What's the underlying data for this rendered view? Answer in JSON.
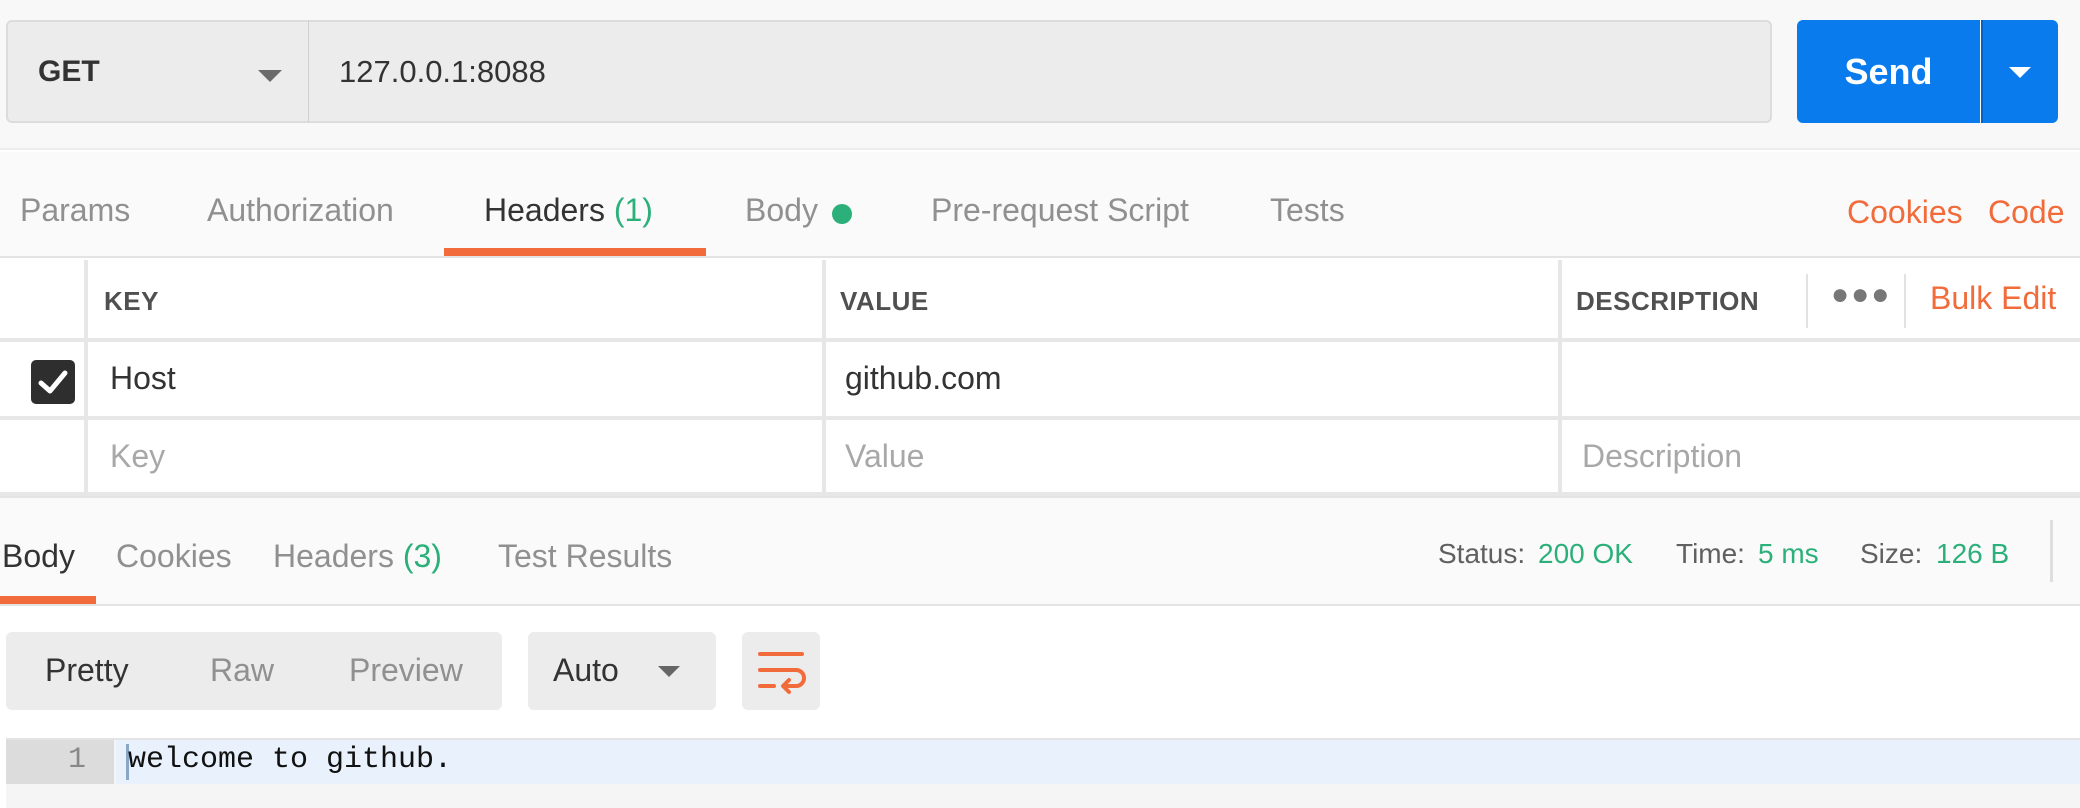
{
  "request": {
    "method": "GET",
    "url": "127.0.0.1:8088",
    "send_label": "Send"
  },
  "request_tabs": {
    "params": "Params",
    "authorization": "Authorization",
    "headers": "Headers",
    "headers_count": "(1)",
    "body": "Body",
    "prerequest": "Pre-request Script",
    "tests": "Tests",
    "cookies_link": "Cookies",
    "code_link": "Code"
  },
  "headers_table": {
    "columns": {
      "key": "KEY",
      "value": "VALUE",
      "description": "DESCRIPTION"
    },
    "more_icon": "more-dots-icon",
    "bulk_edit": "Bulk Edit",
    "rows": [
      {
        "checked": true,
        "key": "Host",
        "value": "github.com",
        "description": ""
      }
    ],
    "placeholders": {
      "key": "Key",
      "value": "Value",
      "description": "Description"
    }
  },
  "response_tabs": {
    "body": "Body",
    "cookies": "Cookies",
    "headers": "Headers",
    "headers_count": "(3)",
    "test_results": "Test Results"
  },
  "response_meta": {
    "status_label": "Status:",
    "status_value": "200 OK",
    "time_label": "Time:",
    "time_value": "5 ms",
    "size_label": "Size:",
    "size_value": "126 B"
  },
  "format": {
    "pretty": "Pretty",
    "raw": "Raw",
    "preview": "Preview",
    "language": "Auto",
    "wrap_icon": "wrap-lines-icon"
  },
  "response_body": {
    "lines": [
      {
        "number": "1",
        "text": "welcome to github."
      }
    ]
  },
  "colors": {
    "accent": "#f26b3a",
    "primary": "#097bed",
    "success": "#2bb07a"
  }
}
